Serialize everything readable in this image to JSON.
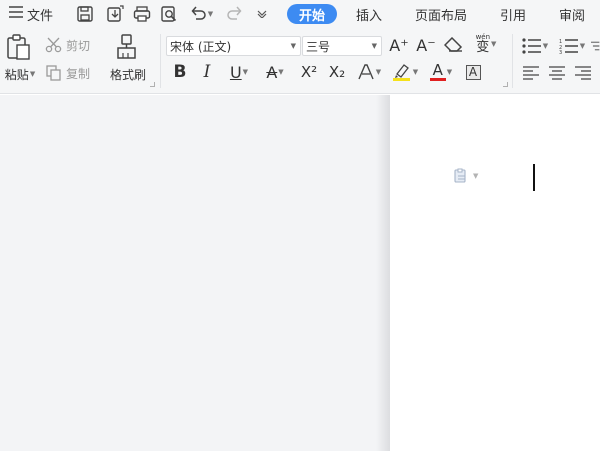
{
  "title_bar": {
    "menu_label": "文件",
    "quick_access": [
      "save-icon",
      "save-as-icon",
      "print-icon",
      "print-preview-icon",
      "undo-icon",
      "redo-icon",
      "customize-icon"
    ],
    "tabs": [
      {
        "label": "开始",
        "active": true
      },
      {
        "label": "插入",
        "active": false
      },
      {
        "label": "页面布局",
        "active": false
      },
      {
        "label": "引用",
        "active": false
      },
      {
        "label": "审阅",
        "active": false
      }
    ]
  },
  "ribbon": {
    "clipboard": {
      "paste_label": "粘贴",
      "cut_label": "剪切",
      "copy_label": "复制",
      "format_painter_label": "格式刷"
    },
    "font": {
      "font_name": "宋体 (正文)",
      "font_size": "三号",
      "bold_glyph": "B",
      "italic_glyph": "I",
      "underline_glyph": "U",
      "strike_glyph": "A",
      "superscript_glyph": "X²",
      "subscript_glyph": "X₂",
      "outline_glyph": "A",
      "font_color_glyph": "A",
      "char_border_glyph": "A",
      "grow_glyph": "A⁺",
      "shrink_glyph": "A⁻",
      "phonetic_glyph": "wén",
      "phonetic_char": "变"
    },
    "colors": {
      "highlight": "#f5e11b",
      "font_color": "#e02020",
      "accent": "#3d8bf2"
    }
  }
}
